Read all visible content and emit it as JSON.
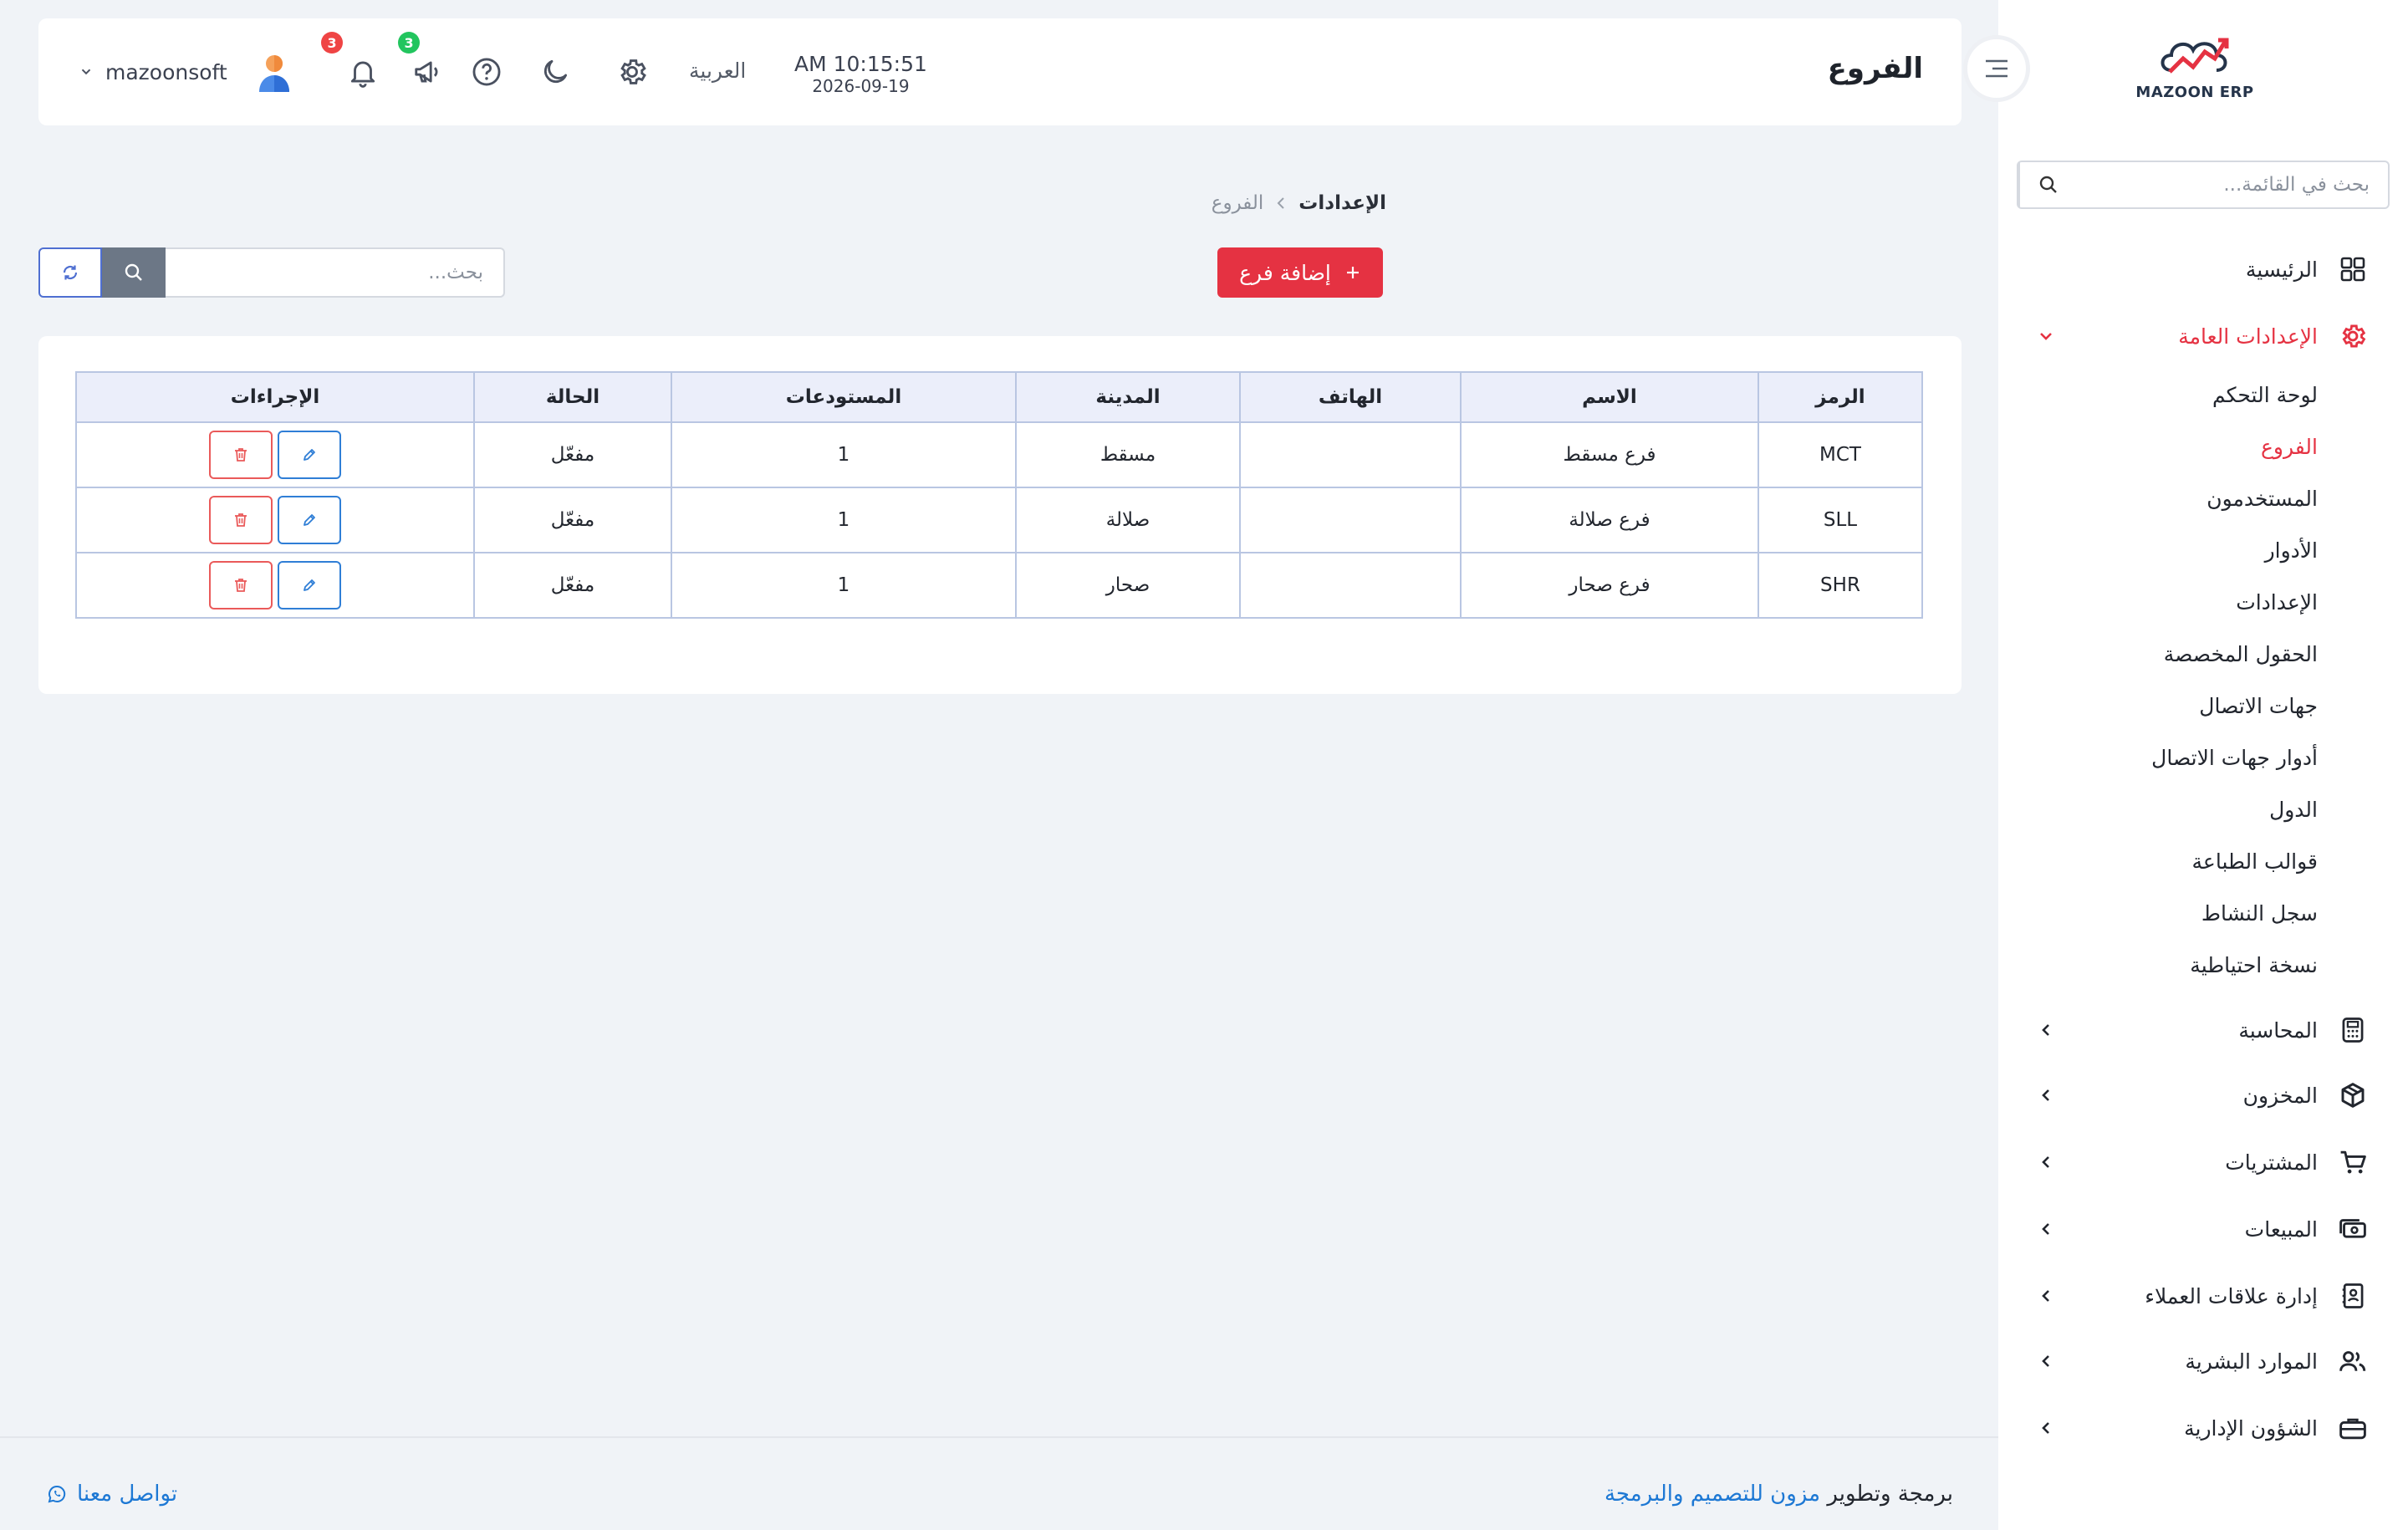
{
  "app": {
    "logo_text": "MAZOON ERP"
  },
  "sidebar": {
    "search_placeholder": "بحث في القائمة...",
    "items": [
      {
        "label": "الرئيسية",
        "icon": "grid-icon"
      },
      {
        "label": "الإعدادات العامة",
        "icon": "gear-icon",
        "active": true
      },
      {
        "label": "المحاسبة",
        "icon": "calculator-icon"
      },
      {
        "label": "المخزون",
        "icon": "box-icon"
      },
      {
        "label": "المشتريات",
        "icon": "cart-icon"
      },
      {
        "label": "المبيعات",
        "icon": "cash-icon"
      },
      {
        "label": "إدارة علاقات العملاء",
        "icon": "contacts-book-icon"
      },
      {
        "label": "الموارد البشرية",
        "icon": "users-icon"
      },
      {
        "label": "الشؤون الإدارية",
        "icon": "briefcase-icon"
      }
    ],
    "sub_items": [
      {
        "label": "لوحة التحكم"
      },
      {
        "label": "الفروع",
        "active": true
      },
      {
        "label": "المستخدمون"
      },
      {
        "label": "الأدوار"
      },
      {
        "label": "الإعدادات"
      },
      {
        "label": "الحقول المخصصة"
      },
      {
        "label": "جهات الاتصال"
      },
      {
        "label": "أدوار جهات الاتصال"
      },
      {
        "label": "الدول"
      },
      {
        "label": "قوالب الطباعة"
      },
      {
        "label": "سجل النشاط"
      },
      {
        "label": "نسخة احتياطية"
      }
    ]
  },
  "header": {
    "title": "الفروع",
    "time": "AM 10:15:51",
    "date": "2026-09-19",
    "language": "العربية",
    "notifications_count": "3",
    "announcements_count": "3",
    "username": "mazoonsoft"
  },
  "breadcrumb": {
    "root": "الإعدادات",
    "current": "الفروع"
  },
  "toolbar": {
    "add_label": "إضافة فرع",
    "search_placeholder": "بحث..."
  },
  "table": {
    "headers": [
      "الرمز",
      "الاسم",
      "الهاتف",
      "المدينة",
      "المستودعات",
      "الحالة",
      "الإجراءات"
    ],
    "rows": [
      {
        "code": "MCT",
        "name": "فرع مسقط",
        "phone": "",
        "city": "مسقط",
        "warehouses": "1",
        "status": "مفعّل"
      },
      {
        "code": "SLL",
        "name": "فرع صلالة",
        "phone": "",
        "city": "صلالة",
        "warehouses": "1",
        "status": "مفعّل"
      },
      {
        "code": "SHR",
        "name": "فرع صحار",
        "phone": "",
        "city": "صحار",
        "warehouses": "1",
        "status": "مفعّل"
      }
    ]
  },
  "footer": {
    "credit_prefix": "برمجة وتطوير",
    "credit_brand": "مزون للتصميم والبرمجة",
    "contact": "تواصل معنا"
  },
  "colors": {
    "accent": "#e53242",
    "link": "#1d78d4",
    "edit": "#2f7ed6",
    "delete": "#ea5a5a",
    "badge_red": "#ef4444",
    "badge_green": "#22c55e"
  }
}
